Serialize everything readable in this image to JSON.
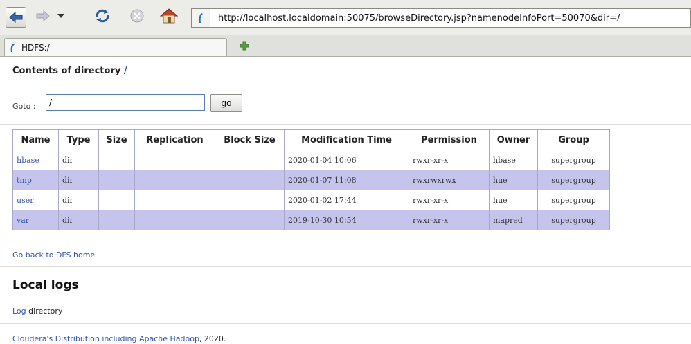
{
  "browser": {
    "url": "http://localhost.localdomain:50075/browseDirectory.jsp?namenodeInfoPort=50070&dir=/",
    "tab_title": "HDFS:/",
    "icons": [
      "back-arrow-icon",
      "forward-arrow-icon",
      "dropdown-arrow-icon",
      "reload-icon",
      "stop-icon",
      "home-icon",
      "page-favicon-icon",
      "new-tab-icon"
    ]
  },
  "page": {
    "heading_text": "Contents of directory",
    "heading_link": "/",
    "goto_label": "Goto :",
    "goto_value": "/",
    "go_button": "go",
    "table": {
      "columns": [
        "Name",
        "Type",
        "Size",
        "Replication",
        "Block Size",
        "Modification Time",
        "Permission",
        "Owner",
        "Group"
      ],
      "rows": [
        {
          "name": "hbase",
          "type": "dir",
          "size": "",
          "replication": "",
          "block_size": "",
          "modification_time": "2020-01-04 10:06",
          "permission": "rwxr-xr-x",
          "owner": "hbase",
          "group": "supergroup"
        },
        {
          "name": "tmp",
          "type": "dir",
          "size": "",
          "replication": "",
          "block_size": "",
          "modification_time": "2020-01-07 11:08",
          "permission": "rwxrwxrwx",
          "owner": "hue",
          "group": "supergroup"
        },
        {
          "name": "user",
          "type": "dir",
          "size": "",
          "replication": "",
          "block_size": "",
          "modification_time": "2020-01-02 17:44",
          "permission": "rwxr-xr-x",
          "owner": "hue",
          "group": "supergroup"
        },
        {
          "name": "var",
          "type": "dir",
          "size": "",
          "replication": "",
          "block_size": "",
          "modification_time": "2019-10-30 10:54",
          "permission": "rwxr-xr-x",
          "owner": "mapred",
          "group": "supergroup"
        }
      ]
    },
    "back_link": "Go back to DFS home",
    "local_logs_title": "Local logs",
    "log_link": "Log",
    "log_suffix": " directory",
    "footer_link_1": "Cloudera's Distribution including Apache Hadoop",
    "footer_suffix": ", 2020."
  },
  "colors": {
    "link": "#3355aa",
    "alt_row": "#c4c4ec",
    "table_border": "#a8a8c8",
    "toolbar_bg": "#ecece9"
  }
}
